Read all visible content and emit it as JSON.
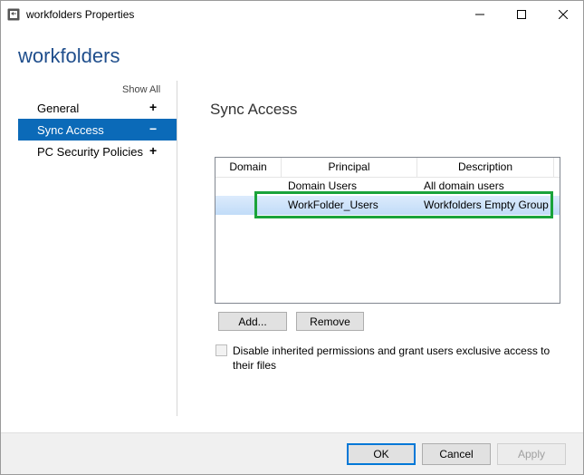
{
  "window": {
    "title": "workfolders Properties",
    "controls": {
      "minimize": "minimize",
      "maximize": "maximize",
      "close": "close"
    }
  },
  "heading": "workfolders",
  "sidebar": {
    "show_all": "Show All",
    "items": [
      {
        "label": "General",
        "toggle": "+",
        "active": false
      },
      {
        "label": "Sync Access",
        "toggle": "−",
        "active": true
      },
      {
        "label": "PC Security Policies",
        "toggle": "+",
        "active": false
      }
    ]
  },
  "section_title": "Sync Access",
  "table": {
    "columns": [
      "Domain",
      "Principal",
      "Description"
    ],
    "rows": [
      {
        "domain": "",
        "principal": "Domain Users",
        "description": "All domain users",
        "selected": false
      },
      {
        "domain": "",
        "principal": "WorkFolder_Users",
        "description": "Workfolders Empty Group",
        "selected": true
      }
    ]
  },
  "buttons": {
    "add": "Add...",
    "remove": "Remove",
    "ok": "OK",
    "cancel": "Cancel",
    "apply": "Apply"
  },
  "checkbox": {
    "label": "Disable inherited permissions and grant users exclusive access to their files",
    "checked": false
  },
  "colors": {
    "accent": "#0b6ab8",
    "heading": "#1f4e8c",
    "highlight": "#1aa33a",
    "selection": "#c1dcf8"
  },
  "icons": {
    "app": "folder-sync-icon",
    "min": "minimize-icon",
    "max": "maximize-icon",
    "close": "close-icon"
  }
}
